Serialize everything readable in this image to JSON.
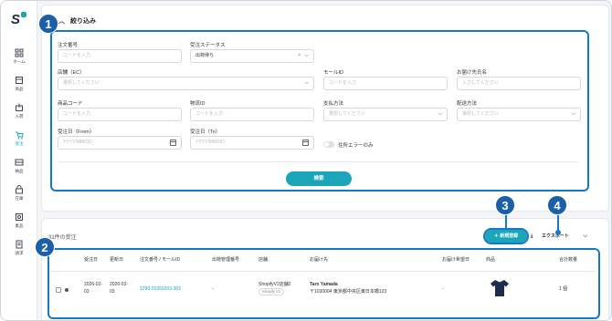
{
  "sidebar": {
    "items": [
      {
        "label": "ホーム",
        "icon": "grid-icon"
      },
      {
        "label": "商品",
        "icon": "product-icon"
      },
      {
        "label": "入荷",
        "icon": "inbound-icon"
      },
      {
        "label": "受注",
        "icon": "order-icon",
        "active": true
      },
      {
        "label": "納品",
        "icon": "delivery-icon"
      },
      {
        "label": "在庫",
        "icon": "stock-icon"
      },
      {
        "label": "素品",
        "icon": "material-icon"
      },
      {
        "label": "請求",
        "icon": "invoice-icon"
      }
    ]
  },
  "filter": {
    "title": "絞り込み",
    "order_no_label": "注文番号",
    "order_no_placeholder": "コードを入力",
    "status_label": "受注ステータス",
    "status_value": "出荷待ち",
    "store_label": "店舗（EC）",
    "store_placeholder": "選択してください",
    "mall_id_label": "モールID",
    "mall_id_placeholder": "コードを入力",
    "recipient_label": "お届け先氏名",
    "recipient_placeholder": "入力してください",
    "product_code_label": "商品コード",
    "product_code_placeholder": "コードを入力",
    "logistics_id_label": "物流ID",
    "logistics_id_placeholder": "コードを入力",
    "payment_label": "支払方法",
    "payment_placeholder": "選択してください",
    "shipping_label": "配送方法",
    "shipping_placeholder": "選択してください",
    "date_from_label": "受注日（From）",
    "date_from_placeholder": "YYYY/MM/DD",
    "date_to_label": "受注日（To）",
    "date_to_placeholder": "YYYY/MM/DD",
    "address_error_toggle": "住所エラーのみ",
    "search_button": "検索"
  },
  "results": {
    "count_text": "31件の受注",
    "new_button": "新規登録",
    "export_button": "エクスポート",
    "columns": [
      "受注日",
      "更新日",
      "注文番号 / モールID",
      "出荷管理番号",
      "店舗",
      "お届け先",
      "お届け希望日",
      "商品",
      "合計数量"
    ],
    "rows": [
      {
        "order_date": "2026-02-03",
        "updated_date": "2026-02-03",
        "order_no": "1290-20260203-002",
        "shipment_no": "-",
        "store": "ShopifyV2店舗2",
        "store_tag": "Shopify V2",
        "recipient_name": "Taro Yamada",
        "recipient_address": "〒1030004 東京都中央区東日本橋123",
        "desired_date": "-",
        "product_icon": "tshirt-icon",
        "quantity": "1 個"
      }
    ]
  },
  "callouts": [
    "1",
    "2",
    "3",
    "4"
  ],
  "colors": {
    "accent": "#1aa5b8",
    "callout": "#1a5fa8",
    "highlight": "#1678c8"
  }
}
